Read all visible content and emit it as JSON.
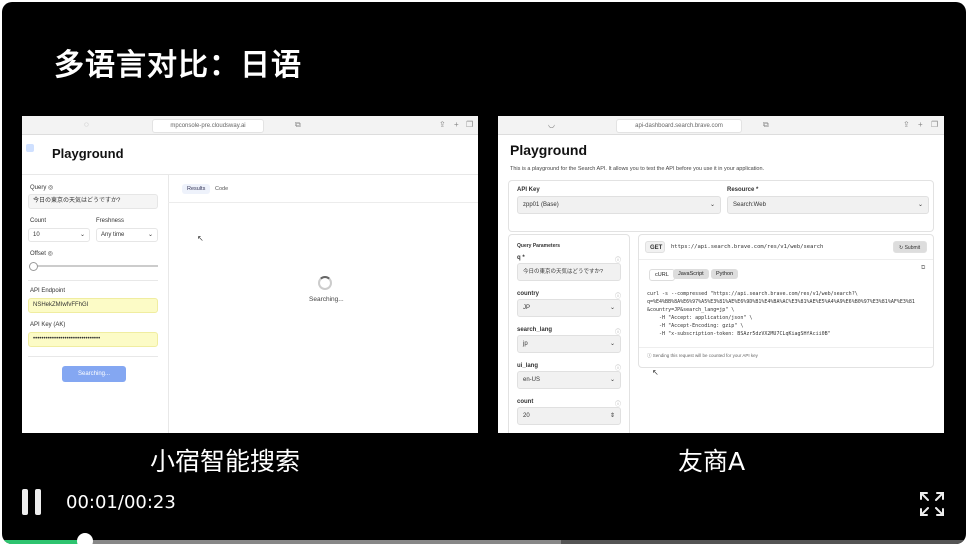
{
  "video": {
    "title": "多语言对比：日语",
    "time_display": "00:01/00:23",
    "progress": 0.043,
    "buffered": 0.58
  },
  "left": {
    "caption": "小宿智能搜索",
    "browser_url": "mpconsole-pre.cloudsway.ai",
    "page_title": "Playground",
    "query_label": "Query ◎",
    "query_value": "今日の東京の天気はどうですか?",
    "count_label": "Count",
    "count_value": "10",
    "freshness_label": "Freshness",
    "freshness_value": "Any time",
    "offset_label": "Offset ◎",
    "endpoint_label": "API Endpoint",
    "endpoint_value": "NSHekZMIwfvFFhGI",
    "apikey_label": "API Key (AK)",
    "apikey_value": "••••••••••••••••••••••••••••••••",
    "searching_button": "Searching...",
    "tab_results": "Results",
    "tab_code": "Code",
    "status_text": "Searching..."
  },
  "right": {
    "caption": "友商A",
    "browser_url": "api-dashboard.search.brave.com",
    "page_title": "Playground",
    "description": "This is a playground for the Search API. It allows you to test the API before you use it in your application.",
    "api_key_label": "API Key",
    "api_key_value": "zpp01 (Base)",
    "resource_label": "Resource *",
    "resource_value": "Search:Web",
    "params_heading": "Query Parameters",
    "q_label": "q *",
    "q_value": "今日の東京の天気はどうですか?",
    "country_label": "country",
    "country_value": "JP",
    "search_lang_label": "search_lang",
    "search_lang_value": "jp",
    "ui_lang_label": "ui_lang",
    "ui_lang_value": "en-US",
    "count_label": "count",
    "count_value": "20",
    "method": "GET",
    "endpoint_url": "https://api.search.brave.com/res/v1/web/search",
    "submit_label": "Submit",
    "code_tabs": [
      "cURL",
      "JavaScript",
      "Python"
    ],
    "code_lines": [
      "curl -s --compressed \"https://api.search.brave.com/res/v1/web/search?\\",
      "q=%E4%BB%8A%E6%97%A5%E3%81%AE%E6%9D%B1%E4%BA%AC%E3%81%AE%E5%A4%A9%E6%B0%97%E3%81%AF%E3%81",
      "&country=JP&search_lang=jp\" \\",
      "    -H \"Accept: application/json\" \\",
      "    -H \"Accept-Encoding: gzip\" \\",
      "    -H \"x-subscription-token: BSAzr5dzVX2MU7CLqKiagSHfAcii0B\""
    ],
    "note": "Sending this request will be counted for your API key"
  }
}
